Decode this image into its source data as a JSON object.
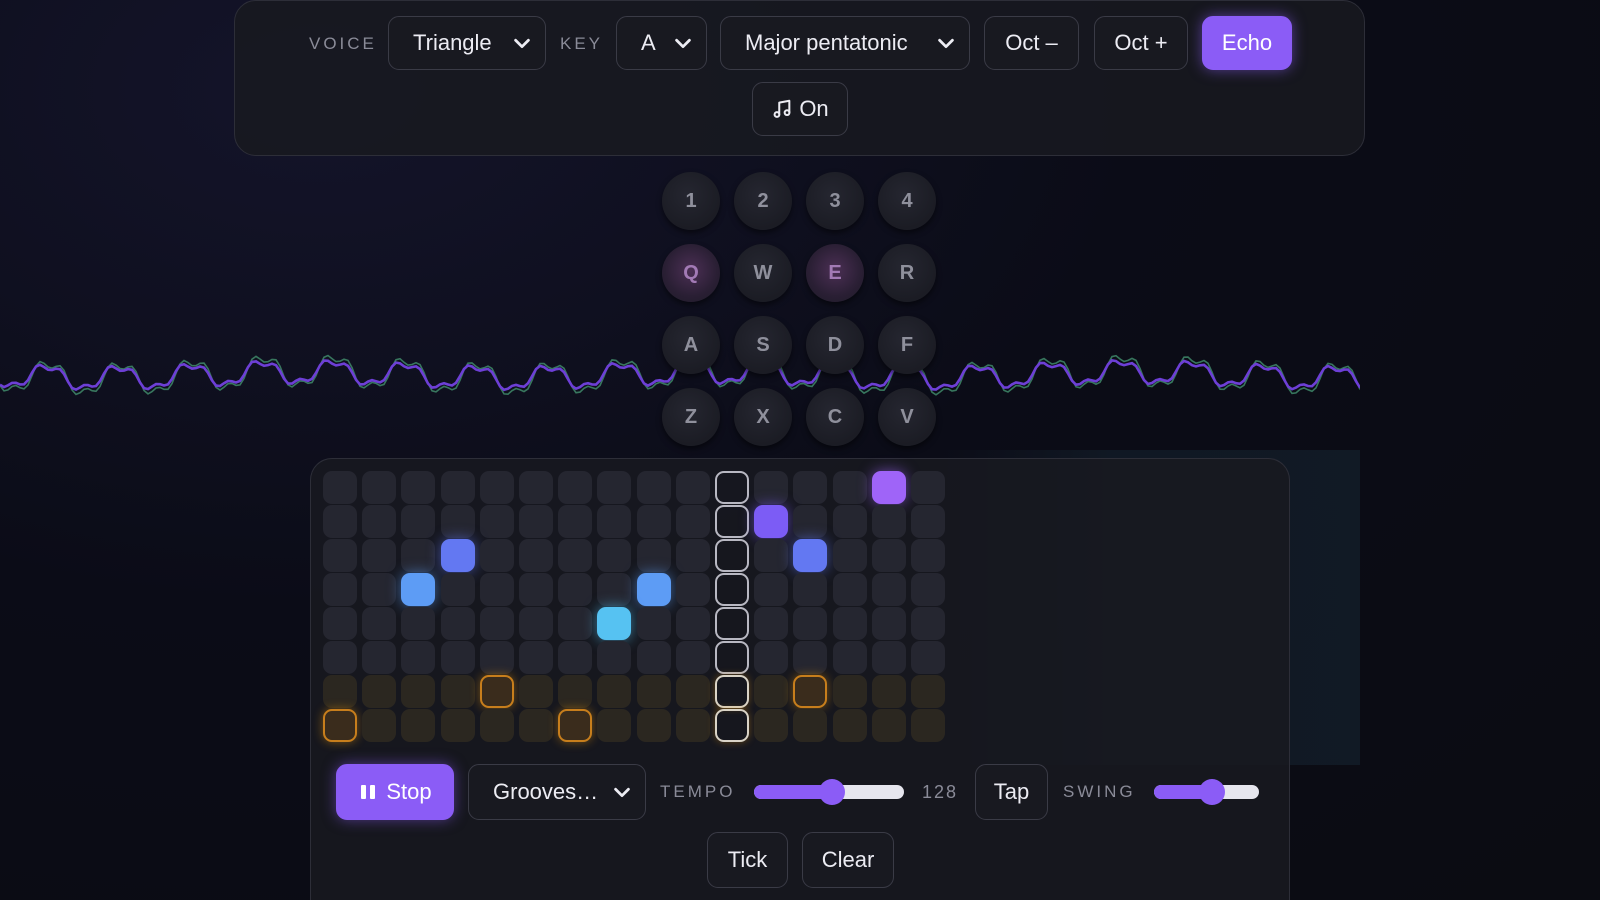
{
  "toolbar": {
    "voice_label": "VOICE",
    "voice_value": "Triangle",
    "key_label": "KEY",
    "key_value": "A",
    "scale_value": "Major pentatonic",
    "oct_down": "Oct –",
    "oct_up": "Oct +",
    "echo": "Echo",
    "sound_toggle": "On"
  },
  "keypad": {
    "rows": [
      [
        "1",
        "2",
        "3",
        "4"
      ],
      [
        "Q",
        "W",
        "E",
        "R"
      ],
      [
        "A",
        "S",
        "D",
        "F"
      ],
      [
        "Z",
        "X",
        "C",
        "V"
      ]
    ],
    "lit": [
      "Q",
      "E"
    ]
  },
  "sequencer": {
    "steps": 16,
    "rows": 8,
    "drum_rows": [
      6,
      7
    ],
    "playhead_step": 10,
    "active_cells": [
      {
        "row": 0,
        "step": 14,
        "color": "violet"
      },
      {
        "row": 1,
        "step": 11,
        "color": "indigo"
      },
      {
        "row": 2,
        "step": 3,
        "color": "blue"
      },
      {
        "row": 2,
        "step": 12,
        "color": "blue"
      },
      {
        "row": 3,
        "step": 2,
        "color": "sky"
      },
      {
        "row": 3,
        "step": 8,
        "color": "sky"
      },
      {
        "row": 4,
        "step": 7,
        "color": "cyan"
      },
      {
        "row": 6,
        "step": 4,
        "color": "amber"
      },
      {
        "row": 6,
        "step": 12,
        "color": "amber"
      },
      {
        "row": 7,
        "step": 0,
        "color": "amber"
      },
      {
        "row": 7,
        "step": 6,
        "color": "amber"
      }
    ]
  },
  "transport": {
    "stop": "Stop",
    "pattern_value": "Grooves…",
    "tempo_label": "TEMPO",
    "tempo_value": "128",
    "tempo_fraction": 0.52,
    "tap": "Tap",
    "swing_label": "SWING",
    "swing_fraction": 0.55,
    "tick": "Tick",
    "clear": "Clear"
  },
  "colors": {
    "accent": "#8b5cf6",
    "amber": "#f59e0b"
  }
}
